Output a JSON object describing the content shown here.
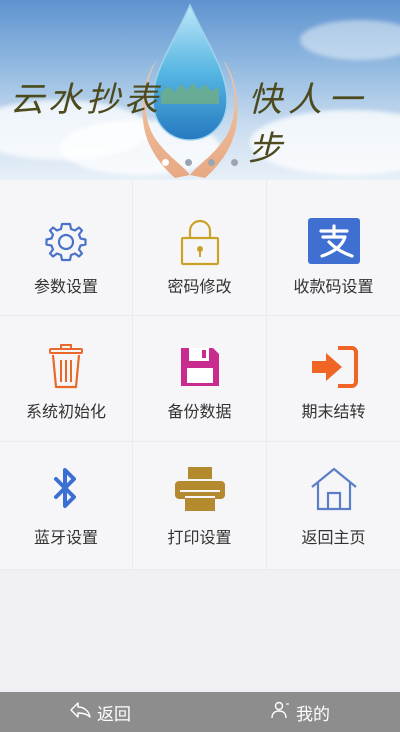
{
  "banner": {
    "text_left": "云水抄表",
    "text_right": "快人一步",
    "slides": 4,
    "active_slide": 0
  },
  "menu": [
    {
      "label": "参数设置",
      "icon": "gear-icon",
      "color": "#4a72c9"
    },
    {
      "label": "密码修改",
      "icon": "lock-icon",
      "color": "#c9a227"
    },
    {
      "label": "收款码设置",
      "icon": "alipay-icon",
      "color": "#3f6fd0"
    },
    {
      "label": "系统初始化",
      "icon": "trash-icon",
      "color": "#e8692a"
    },
    {
      "label": "备份数据",
      "icon": "floppy-disk-icon",
      "color": "#c72c8e"
    },
    {
      "label": "期末结转",
      "icon": "sign-in-arrow-icon",
      "color": "#f06424"
    },
    {
      "label": "蓝牙设置",
      "icon": "bluetooth-icon",
      "color": "#3b6fd1"
    },
    {
      "label": "打印设置",
      "icon": "printer-icon",
      "color": "#b38a2d"
    },
    {
      "label": "返回主页",
      "icon": "home-icon",
      "color": "#5a7ec7"
    }
  ],
  "bottom_nav": {
    "back_label": "返回",
    "mine_label": "我的"
  }
}
